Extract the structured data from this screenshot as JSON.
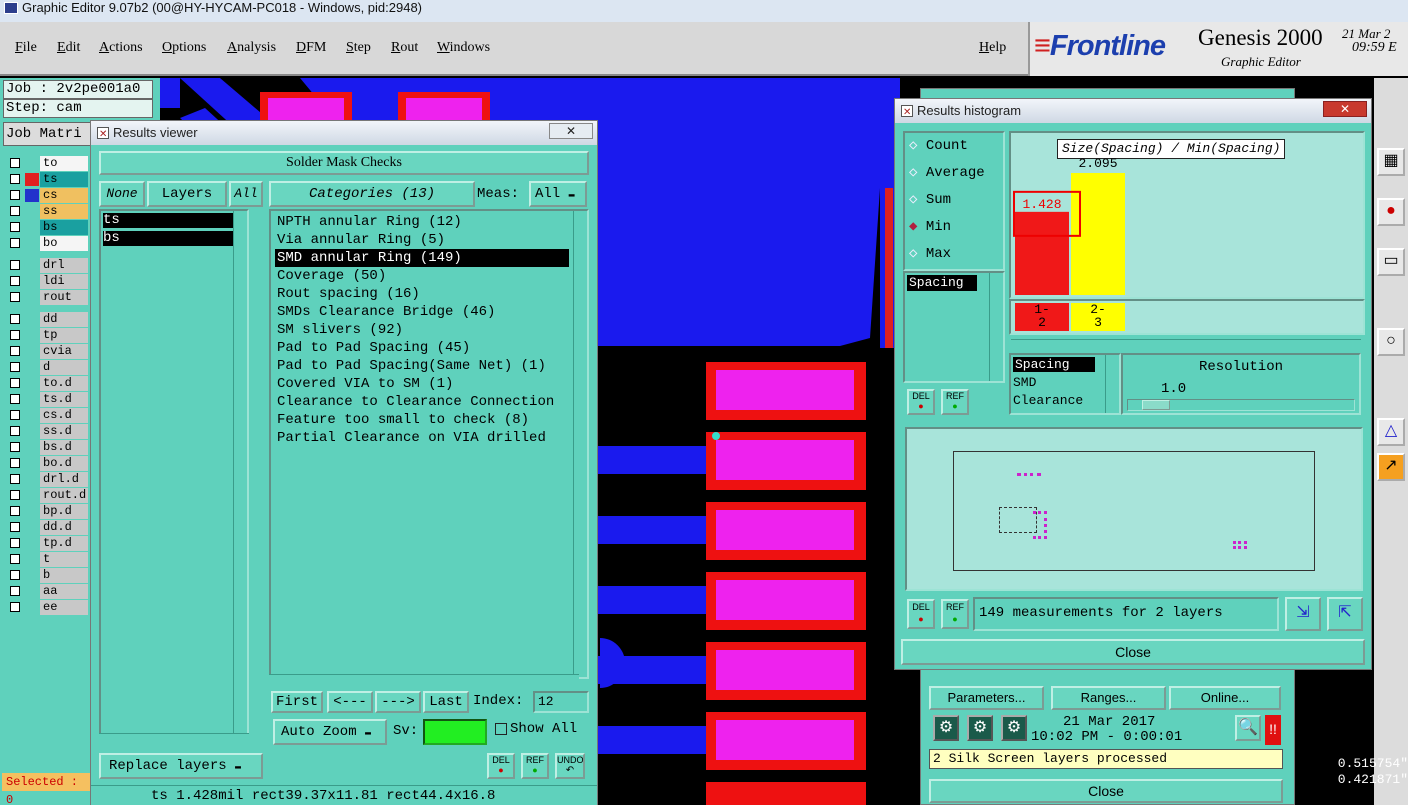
{
  "titlebar": {
    "text": "Graphic Editor 9.07b2 (00@HY-HYCAM-PC018 - Windows, pid:2948)"
  },
  "menu": {
    "items": [
      "File",
      "Edit",
      "Actions",
      "Options",
      "Analysis",
      "DFM",
      "Step",
      "Rout",
      "Windows"
    ],
    "help": "Help"
  },
  "brand": {
    "logo": "Frontline",
    "product": "Genesis 2000",
    "subtitle": "Graphic Editor",
    "date": "21 Mar 2",
    "time": "09:59 E"
  },
  "left_panel": {
    "job": "Job : 2v2pe001a0",
    "step": "Step: cam",
    "job_matrix": "Job Matri",
    "layers": [
      {
        "name": "to",
        "color": "#f5f5f5"
      },
      {
        "name": "ts",
        "color": "#1aa0a0",
        "highlight": "#e02020"
      },
      {
        "name": "cs",
        "color": "#f0c060",
        "sw": "#2233cc"
      },
      {
        "name": "ss",
        "color": "#f0c060"
      },
      {
        "name": "bs",
        "color": "#1aa0a0"
      },
      {
        "name": "bo",
        "color": "#f5f5f5"
      },
      {
        "name": "drl",
        "color": "#c8c8c8"
      },
      {
        "name": "ldi",
        "color": "#c8c8c8"
      },
      {
        "name": "rout",
        "color": "#c8c8c8"
      },
      {
        "name": "dd",
        "color": "#c8c8c8"
      },
      {
        "name": "tp",
        "color": "#c8c8c8"
      },
      {
        "name": "cvia",
        "color": "#c8c8c8"
      },
      {
        "name": "d",
        "color": "#c8c8c8"
      },
      {
        "name": "to.d",
        "color": "#c8c8c8"
      },
      {
        "name": "ts.d",
        "color": "#c8c8c8"
      },
      {
        "name": "cs.d",
        "color": "#c8c8c8"
      },
      {
        "name": "ss.d",
        "color": "#c8c8c8"
      },
      {
        "name": "bs.d",
        "color": "#c8c8c8"
      },
      {
        "name": "bo.d",
        "color": "#c8c8c8"
      },
      {
        "name": "drl.d",
        "color": "#c8c8c8"
      },
      {
        "name": "rout.d",
        "color": "#c8c8c8"
      },
      {
        "name": "bp.d",
        "color": "#c8c8c8"
      },
      {
        "name": "dd.d",
        "color": "#c8c8c8"
      },
      {
        "name": "tp.d",
        "color": "#c8c8c8"
      },
      {
        "name": "t",
        "color": "#c8c8c8"
      },
      {
        "name": "b",
        "color": "#c8c8c8"
      },
      {
        "name": "aa",
        "color": "#c8c8c8"
      },
      {
        "name": "ee",
        "color": "#c8c8c8"
      }
    ],
    "selected": "Selected : 0"
  },
  "results_viewer": {
    "title": "Results viewer",
    "header": "Solder Mask Checks",
    "none_btn": "None",
    "layers_btn": "Layers",
    "all_btn": "All",
    "categories_btn": "Categories (13)",
    "meas_label": "Meas:",
    "meas_value": "All",
    "layers": [
      "ts",
      "bs"
    ],
    "categories": [
      "NPTH annular Ring (12)",
      "Via annular Ring (5)",
      "SMD annular Ring (149)",
      "Coverage (50)",
      "Rout spacing (16)",
      "SMDs Clearance Bridge (46)",
      "SM slivers (92)",
      "Pad to Pad Spacing (45)",
      "Pad to Pad Spacing(Same Net) (1)",
      "Covered VIA to SM (1)",
      "Clearance to Clearance Connection",
      "Feature too small to check (8)",
      "Partial Clearance on VIA drilled"
    ],
    "selected_index": 2,
    "first_btn": "First",
    "prev_btn": "<---",
    "next_btn": "--->",
    "last_btn": "Last",
    "index_label": "Index:",
    "index_value": "12",
    "auto_zoom": "Auto Zoom",
    "sv_label": "Sv:",
    "show_all": "Show All",
    "replace_layers": "Replace layers",
    "del_label": "DEL",
    "ref_label": "REF",
    "undo_label": "UNDO",
    "status": "ts 1.428mil  rect39.37x11.81  rect44.4x16.8"
  },
  "histogram": {
    "title": "Results histogram",
    "radios": [
      "Count",
      "Average",
      "Sum",
      "Min",
      "Max"
    ],
    "radio_selected": "Min",
    "list_item": "Spacing",
    "chart_title": "Size(Spacing) / Min(Spacing)",
    "chart_data": {
      "type": "bar",
      "categories": [
        "1-2",
        "2-3"
      ],
      "values": [
        1.428,
        2.095
      ],
      "title": "Size(Spacing) / Min(Spacing)",
      "colors": [
        "#f01818",
        "#ffff00"
      ],
      "value_labels": [
        "1.428",
        "2.095"
      ],
      "ylim": [
        0,
        2.095
      ]
    },
    "bin_labels": [
      "1-\n2",
      "2-\n3"
    ],
    "type_list": [
      "Spacing",
      "SMD",
      "Clearance"
    ],
    "resolution_label": "Resolution",
    "resolution_value": "1.0",
    "measurements": "149 measurements for 2 layers",
    "close": "Close",
    "del_label": "DEL",
    "ref_label": "REF"
  },
  "back_panel": {
    "parameters": "Parameters...",
    "ranges": "Ranges...",
    "online": "Online...",
    "date": "21 Mar 2017",
    "time": "10:02 PM - 0:00:01",
    "message": "2 Silk Screen layers processed",
    "close": "Close"
  },
  "coords": {
    "x": "0.515754\"",
    "y": "0.421871\""
  }
}
